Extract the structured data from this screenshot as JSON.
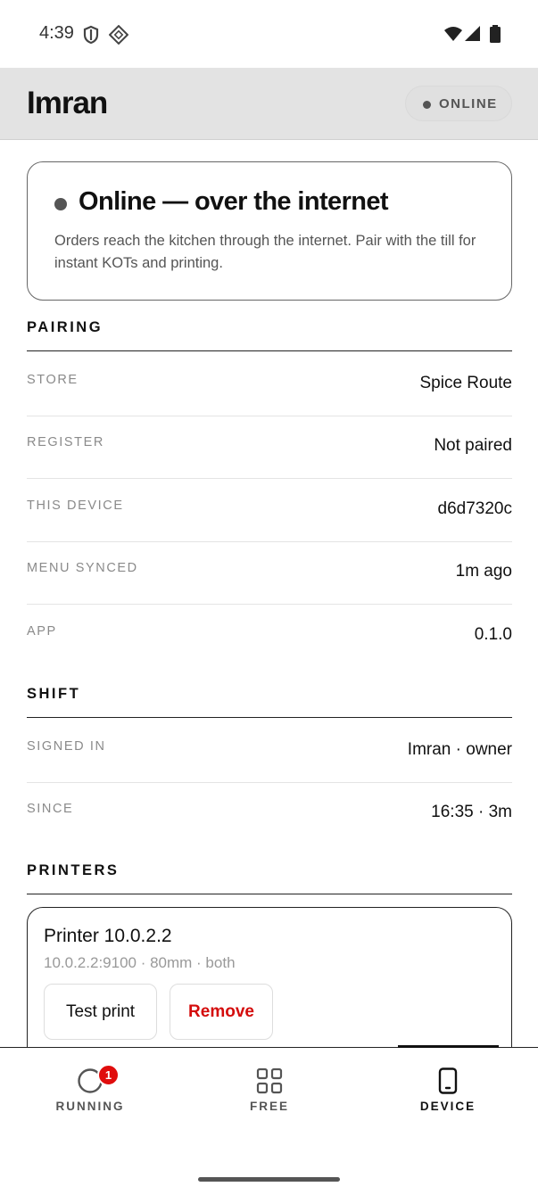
{
  "status_bar": {
    "time": "4:39",
    "icons": [
      "shield-icon",
      "diamond-grid-icon",
      "wifi-icon",
      "cell-signal-icon",
      "battery-icon"
    ]
  },
  "header": {
    "title": "Imran",
    "status_label": "ONLINE"
  },
  "connection": {
    "headline": "Online — over the internet",
    "description": "Orders reach the kitchen through the internet. Pair with the till for instant KOTs and printing."
  },
  "pairing": {
    "title": "PAIRING",
    "rows": [
      {
        "label": "STORE",
        "value": "Spice Route"
      },
      {
        "label": "REGISTER",
        "value": "Not paired"
      },
      {
        "label": "THIS DEVICE",
        "value": "d6d7320c"
      },
      {
        "label": "MENU SYNCED",
        "value": "1m ago"
      },
      {
        "label": "APP",
        "value": "0.1.0"
      }
    ]
  },
  "shift": {
    "title": "SHIFT",
    "rows": [
      {
        "label": "SIGNED IN",
        "value": "Imran · owner"
      },
      {
        "label": "SINCE",
        "value": "16:35 · 3m"
      }
    ]
  },
  "printers": {
    "title": "PRINTERS",
    "items": [
      {
        "name": "Printer 10.0.2.2",
        "details": "10.0.2.2:9100 · 80mm · both",
        "test_label": "Test print",
        "remove_label": "Remove"
      }
    ]
  },
  "bottom_nav": {
    "items": [
      {
        "label": "RUNNING",
        "icon": "circle-icon",
        "badge": "1"
      },
      {
        "label": "FREE",
        "icon": "grid-icon"
      },
      {
        "label": "DEVICE",
        "icon": "phone-icon",
        "active": true
      }
    ]
  },
  "colors": {
    "header_bg": "#e3e3e3",
    "danger": "#d40c0c",
    "badge": "#e00d0d",
    "muted": "#8a8a8a"
  }
}
